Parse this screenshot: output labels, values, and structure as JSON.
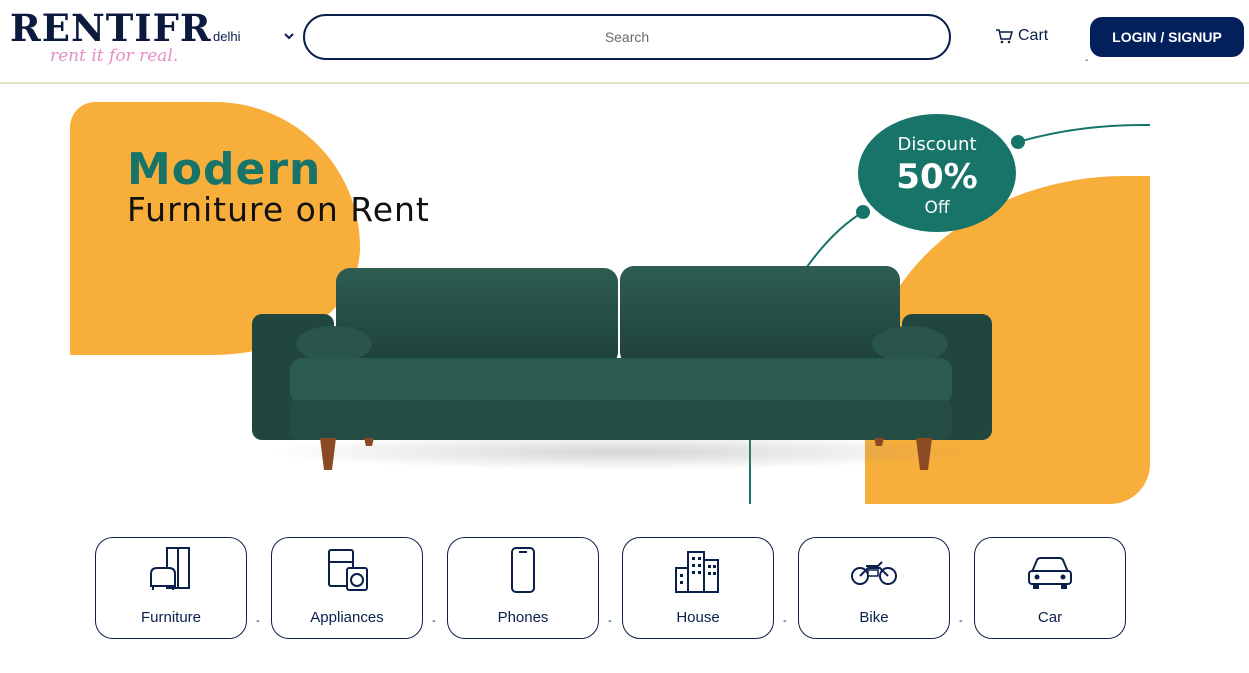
{
  "header": {
    "logo_main": "RENTIFR",
    "logo_tagline": "rent it for real.",
    "city": "delhi",
    "search_placeholder": "Search",
    "cart_label": "Cart",
    "login_label": "LOGIN / SIGNUP"
  },
  "hero": {
    "title_line1": "Modern",
    "title_line2": "Furniture on Rent",
    "discount_label": "Discount",
    "discount_value": "50%",
    "discount_suffix": "Off"
  },
  "categories": [
    {
      "label": "Furniture",
      "icon": "furniture-icon"
    },
    {
      "label": "Appliances",
      "icon": "appliances-icon"
    },
    {
      "label": "Phones",
      "icon": "phone-icon"
    },
    {
      "label": "House",
      "icon": "house-icon"
    },
    {
      "label": "Bike",
      "icon": "bike-icon"
    },
    {
      "label": "Car",
      "icon": "car-icon"
    }
  ],
  "colors": {
    "navy": "#0b1f4d",
    "accent_orange": "#f7ae3b",
    "teal": "#187468",
    "button": "#04205c",
    "tagline_pink": "#e38fc1"
  }
}
